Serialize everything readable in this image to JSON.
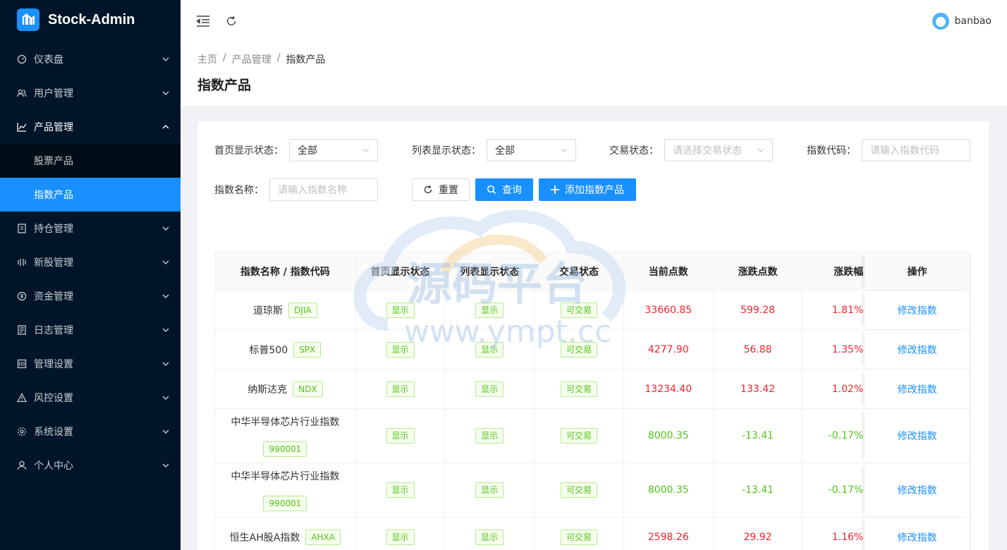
{
  "app": {
    "name": "Stock-Admin"
  },
  "sidebar": {
    "items": [
      {
        "label": "仪表盘",
        "icon": "dashboard-icon"
      },
      {
        "label": "用户管理",
        "icon": "users-icon"
      },
      {
        "label": "产品管理",
        "icon": "chart-icon",
        "open": true,
        "children": [
          {
            "label": "股票产品"
          },
          {
            "label": "指数产品",
            "active": true
          }
        ]
      },
      {
        "label": "持仓管理",
        "icon": "position-icon"
      },
      {
        "label": "新股管理",
        "icon": "ipo-icon"
      },
      {
        "label": "资金管理",
        "icon": "money-icon"
      },
      {
        "label": "日志管理",
        "icon": "log-icon"
      },
      {
        "label": "管理设置",
        "icon": "admin-settings-icon"
      },
      {
        "label": "风控设置",
        "icon": "warning-icon"
      },
      {
        "label": "系统设置",
        "icon": "gear-icon"
      },
      {
        "label": "个人中心",
        "icon": "user-icon"
      }
    ]
  },
  "header": {
    "username": "banbao"
  },
  "breadcrumb": [
    "主页",
    "产品管理",
    "指数产品"
  ],
  "page_title": "指数产品",
  "filters": {
    "home_status": {
      "label": "首页显示状态",
      "value": "全部"
    },
    "list_status": {
      "label": "列表显示状态",
      "value": "全部"
    },
    "trade_status": {
      "label": "交易状态",
      "placeholder": "请选择交易状态"
    },
    "index_code": {
      "label": "指数代码",
      "placeholder": "请输入指数代码"
    },
    "index_name": {
      "label": "指数名称",
      "placeholder": "请输入指数名称"
    },
    "colon": "："
  },
  "buttons": {
    "reset": "重置",
    "search": "查询",
    "add": "添加指数产品"
  },
  "table": {
    "columns": [
      "指数名称 / 指数代码",
      "首页显示状态",
      "列表显示状态",
      "交易状态",
      "当前点数",
      "涨跌点数",
      "涨跌幅",
      "操作"
    ],
    "rows": [
      {
        "name": "道琼斯",
        "code": "DJIA",
        "home": "显示",
        "list": "显示",
        "trade": "可交易",
        "price": "33660.85",
        "change": "599.28",
        "pct": "1.81%",
        "dir": "up",
        "action": "修改指数"
      },
      {
        "name": "标普500",
        "code": "SPX",
        "home": "显示",
        "list": "显示",
        "trade": "可交易",
        "price": "4277.90",
        "change": "56.88",
        "pct": "1.35%",
        "dir": "up",
        "action": "修改指数"
      },
      {
        "name": "纳斯达克",
        "code": "NDX",
        "home": "显示",
        "list": "显示",
        "trade": "可交易",
        "price": "13234.40",
        "change": "133.42",
        "pct": "1.02%",
        "dir": "up",
        "action": "修改指数"
      },
      {
        "name": "中华半导体芯片行业指数",
        "code": "990001",
        "home": "显示",
        "list": "显示",
        "trade": "可交易",
        "price": "8000.35",
        "change": "-13.41",
        "pct": "-0.17%",
        "dir": "down",
        "action": "修改指数",
        "tall": true
      },
      {
        "name": "中华半导体芯片行业指数",
        "code": "990001",
        "home": "显示",
        "list": "显示",
        "trade": "可交易",
        "price": "8000.35",
        "change": "-13.41",
        "pct": "-0.17%",
        "dir": "down",
        "action": "修改指数",
        "tall": true
      },
      {
        "name": "恒生AH股A指数",
        "code": "AHXA",
        "home": "显示",
        "list": "显示",
        "trade": "可交易",
        "price": "2598.26",
        "change": "29.92",
        "pct": "1.16%",
        "dir": "up",
        "action": "修改指数"
      }
    ]
  },
  "watermark": {
    "title": "源码平台",
    "url": "www.ympt.cc"
  },
  "colors": {
    "primary": "#1890ff",
    "sidebar_bg": "#001529",
    "up": "#f5222d",
    "down": "#52c41a"
  }
}
